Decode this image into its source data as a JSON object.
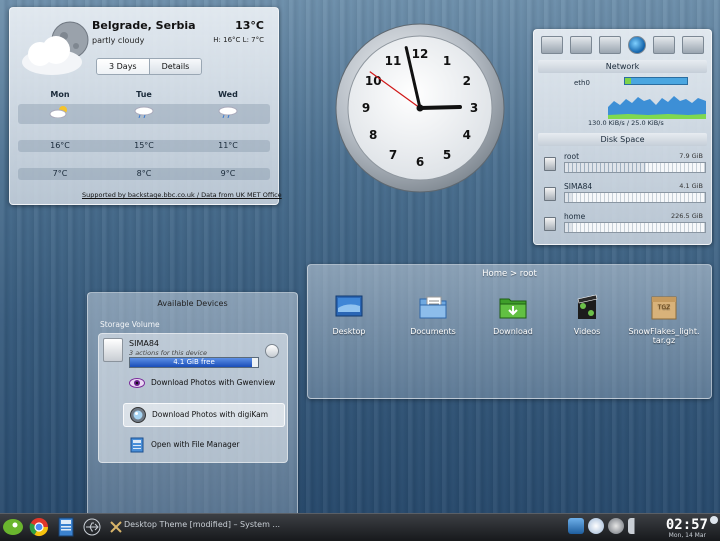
{
  "weather": {
    "city": "Belgrade, Serbia",
    "temperature": "13°C",
    "condition": "partly cloudy",
    "high_low": "H: 16°C L: 7°C",
    "tabs": [
      "3 Days",
      "Details"
    ],
    "days": [
      "Mon",
      "Tue",
      "Wed"
    ],
    "highs": [
      "16°C",
      "15°C",
      "11°C"
    ],
    "lows": [
      "7°C",
      "8°C",
      "9°C"
    ],
    "footer": "Supported by backstage.bbc.co.uk / Data from UK MET Office"
  },
  "clock": {
    "numerals": [
      "12",
      "1",
      "2",
      "3",
      "4",
      "5",
      "6",
      "7",
      "8",
      "9",
      "10",
      "11"
    ],
    "hour": 2,
    "minute": 57,
    "second": 51
  },
  "sysmon": {
    "network_header": "Network",
    "interface": "eth0",
    "rate": "130.0 KiB/s / 25.0 KiB/s",
    "disk_header": "Disk Space",
    "disks": [
      {
        "name": "root",
        "size": "7.9 GiB",
        "used": 0.58
      },
      {
        "name": "SIMA84",
        "size": "4.1 GiB",
        "used": 0.05
      },
      {
        "name": "home",
        "size": "226.5 GiB",
        "used": 0.05
      }
    ]
  },
  "folderview": {
    "title": "Home > root",
    "items": [
      {
        "label": "Desktop",
        "icon": "desktop-folder-icon"
      },
      {
        "label": "Documents",
        "icon": "documents-folder-icon"
      },
      {
        "label": "Download",
        "icon": "download-folder-icon"
      },
      {
        "label": "Videos",
        "icon": "videos-folder-icon"
      },
      {
        "label": "SnowFlakes_light.tar.gz",
        "label_line1": "SnowFlakes_light.",
        "label_line2": "tar.gz",
        "icon": "archive-icon"
      }
    ]
  },
  "devices": {
    "title": "Available Devices",
    "section": "Storage Volume",
    "device_name": "SIMA84",
    "device_actions": "3 actions for this device",
    "free_space": "4.1 GiB free",
    "free_fraction": 0.95,
    "actions": [
      "Download Photos with Gwenview",
      "Download Photos with digiKam",
      "Open with File Manager"
    ]
  },
  "taskbar": {
    "task": "Desktop Theme [modified] – System ...",
    "time": "02:57",
    "date": "Mon, 14 Mar"
  },
  "colors": {
    "accent_blue": "#1a4db8",
    "net_green": "#7ed34a",
    "net_blue": "#4aa6e0",
    "second_hand": "#d01818"
  }
}
